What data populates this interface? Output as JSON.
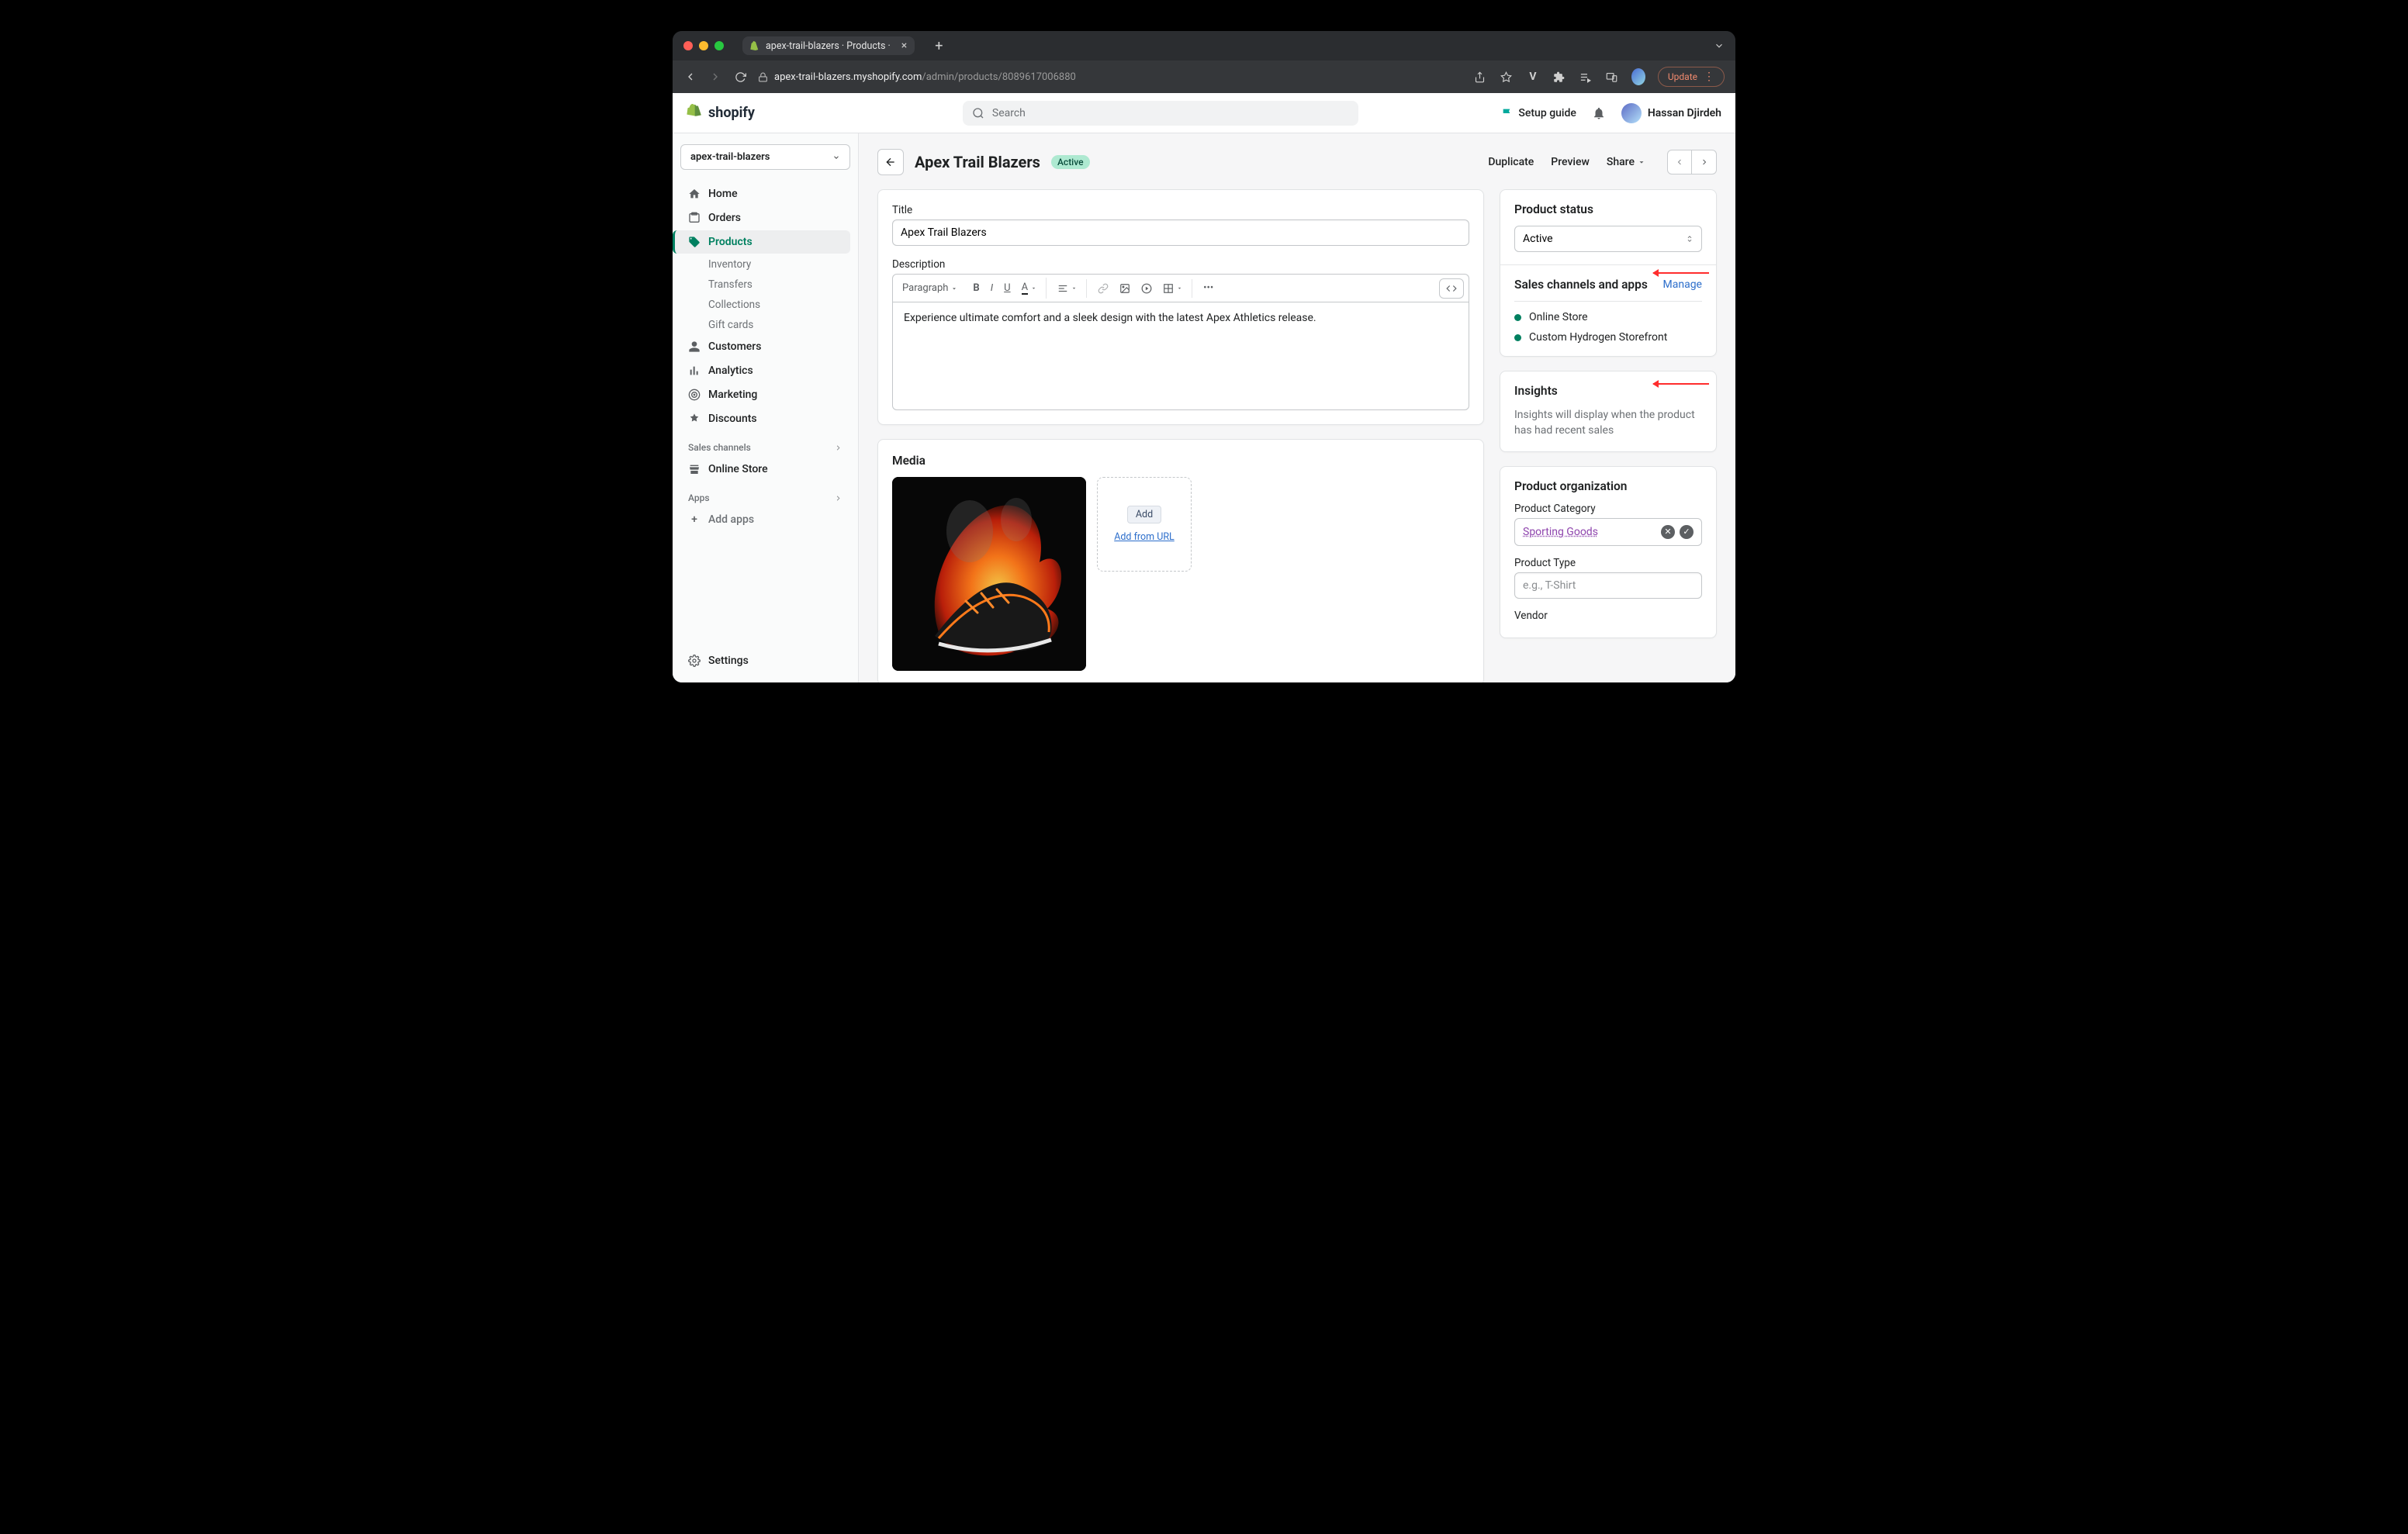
{
  "browser": {
    "tab_title": "apex-trail-blazers · Products ·",
    "url_domain": "apex-trail-blazers.myshopify.com",
    "url_path": "/admin/products/8089617006880",
    "update_label": "Update"
  },
  "topbar": {
    "logo_text": "shopify",
    "search_placeholder": "Search",
    "setup_guide": "Setup guide",
    "username": "Hassan Djirdeh"
  },
  "sidebar": {
    "store_name": "apex-trail-blazers",
    "items": [
      {
        "label": "Home"
      },
      {
        "label": "Orders"
      },
      {
        "label": "Products"
      },
      {
        "label": "Customers"
      },
      {
        "label": "Analytics"
      },
      {
        "label": "Marketing"
      },
      {
        "label": "Discounts"
      }
    ],
    "products_sub": [
      {
        "label": "Inventory"
      },
      {
        "label": "Transfers"
      },
      {
        "label": "Collections"
      },
      {
        "label": "Gift cards"
      }
    ],
    "sales_channels_label": "Sales channels",
    "online_store_label": "Online Store",
    "apps_label": "Apps",
    "add_apps_label": "Add apps",
    "settings_label": "Settings"
  },
  "page": {
    "title": "Apex Trail Blazers",
    "badge": "Active",
    "duplicate": "Duplicate",
    "preview": "Preview",
    "share": "Share"
  },
  "product": {
    "title_label": "Title",
    "title_value": "Apex Trail Blazers",
    "description_label": "Description",
    "paragraph_label": "Paragraph",
    "description_value": "Experience ultimate comfort and a sleek design with the latest Apex Athletics release.",
    "media_heading": "Media",
    "media_add": "Add",
    "media_add_url": "Add from URL"
  },
  "status_card": {
    "heading": "Product status",
    "status_value": "Active",
    "channels_heading": "Sales channels and apps",
    "manage": "Manage",
    "channels": [
      {
        "name": "Online Store"
      },
      {
        "name": "Custom Hydrogen Storefront"
      }
    ]
  },
  "insights_card": {
    "heading": "Insights",
    "text": "Insights will display when the product has had recent sales"
  },
  "organization_card": {
    "heading": "Product organization",
    "category_label": "Product Category",
    "category_value": "Sporting Goods",
    "type_label": "Product Type",
    "type_placeholder": "e.g., T-Shirt",
    "vendor_label": "Vendor"
  }
}
